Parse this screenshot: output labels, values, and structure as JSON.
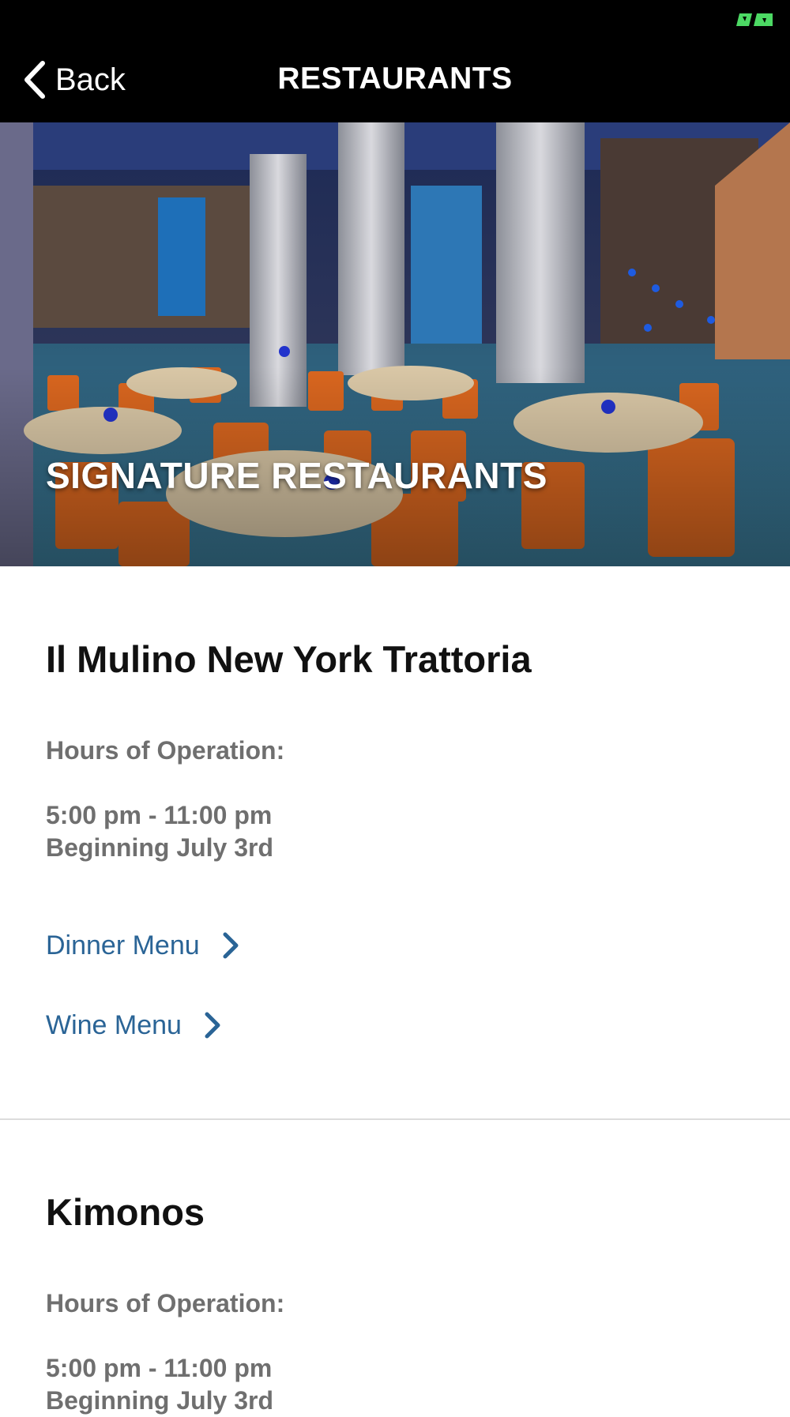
{
  "header": {
    "back_label": "Back",
    "title": "RESTAURANTS"
  },
  "status_bar": {
    "indicator_color": "#4cd964"
  },
  "hero": {
    "title": "SIGNATURE RESTAURANTS"
  },
  "restaurants": [
    {
      "name": "Il Mulino New York Trattoria",
      "hours_label": "Hours of Operation:",
      "hours_time": "5:00 pm - 11:00 pm",
      "hours_note": "Beginning July 3rd",
      "links": [
        {
          "label": "Dinner Menu"
        },
        {
          "label": "Wine Menu"
        }
      ]
    },
    {
      "name": "Kimonos",
      "hours_label": "Hours of Operation:",
      "hours_time": "5:00 pm - 11:00 pm",
      "hours_note": "Beginning July 3rd"
    }
  ],
  "colors": {
    "link": "#2a6496",
    "muted_text": "#6f6f6f",
    "nav_bg": "#000000"
  }
}
